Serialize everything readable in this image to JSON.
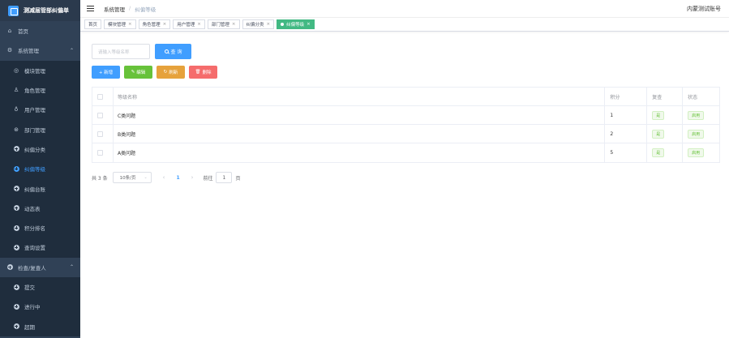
{
  "app": {
    "title": "测减届管部纠偏单"
  },
  "sidebar": {
    "items": [
      {
        "label": "首页",
        "icon": "home-icon",
        "type": "top"
      },
      {
        "label": "系统管理",
        "icon": "gear-icon",
        "type": "parent"
      },
      {
        "label": "模块管理",
        "icon": "module-icon",
        "type": "sub"
      },
      {
        "label": "角色管理",
        "icon": "user-icon",
        "type": "sub"
      },
      {
        "label": "用户管理",
        "icon": "bulb-icon",
        "type": "sub"
      },
      {
        "label": "部门管理",
        "icon": "dept-icon",
        "type": "sub"
      },
      {
        "label": "纠偏分类",
        "icon": "plus-circle-icon",
        "type": "sub"
      },
      {
        "label": "纠偏等级",
        "icon": "plus-circle-icon",
        "type": "sub",
        "active": true
      },
      {
        "label": "纠偏台账",
        "icon": "plus-circle-icon",
        "type": "sub"
      },
      {
        "label": "动态表",
        "icon": "plus-circle-icon",
        "type": "sub"
      },
      {
        "label": "积分排名",
        "icon": "plus-circle-icon",
        "type": "sub"
      },
      {
        "label": "查询设置",
        "icon": "plus-circle-icon",
        "type": "sub"
      },
      {
        "label": "检查/复查人",
        "icon": "plus-circle-icon",
        "type": "parent"
      },
      {
        "label": "提交",
        "icon": "plus-circle-icon",
        "type": "sub"
      },
      {
        "label": "进行中",
        "icon": "plus-circle-icon",
        "type": "sub"
      },
      {
        "label": "超期",
        "icon": "plus-circle-icon",
        "type": "sub"
      }
    ]
  },
  "header": {
    "breadcrumb": [
      "系统管理",
      "纠偏等级"
    ],
    "user": "内蒙测试账号"
  },
  "tags": [
    {
      "label": "首页",
      "closable": false
    },
    {
      "label": "模块管理",
      "closable": true
    },
    {
      "label": "角色管理",
      "closable": true
    },
    {
      "label": "用户管理",
      "closable": true
    },
    {
      "label": "部门管理",
      "closable": true
    },
    {
      "label": "纠偏分类",
      "closable": true
    },
    {
      "label": "纠偏等级",
      "closable": true,
      "active": true
    }
  ],
  "search": {
    "placeholder": "请输入等级名称",
    "button": "查 询"
  },
  "toolbar": {
    "add": "+ 新增",
    "edit": "编辑",
    "refresh": "刷新",
    "delete": "删除"
  },
  "table": {
    "headers": [
      "等级名称",
      "积分",
      "复查",
      "状态"
    ],
    "rows": [
      {
        "name": "C类问题",
        "score": "1",
        "review": "是",
        "status": "启用"
      },
      {
        "name": "B类问题",
        "score": "2",
        "review": "是",
        "status": "启用"
      },
      {
        "name": "A类问题",
        "score": "5",
        "review": "是",
        "status": "启用"
      }
    ]
  },
  "pagination": {
    "total": "共 3 条",
    "page_size": "10条/页",
    "current": "1",
    "goto_label": "前往",
    "goto_value": "1",
    "page_suffix": "页"
  },
  "colors": {
    "primary": "#409eff",
    "success": "#67c23a",
    "warning": "#e6a23c",
    "danger": "#f56c6c",
    "sidebar": "#304156",
    "tag_active": "#42b983"
  }
}
